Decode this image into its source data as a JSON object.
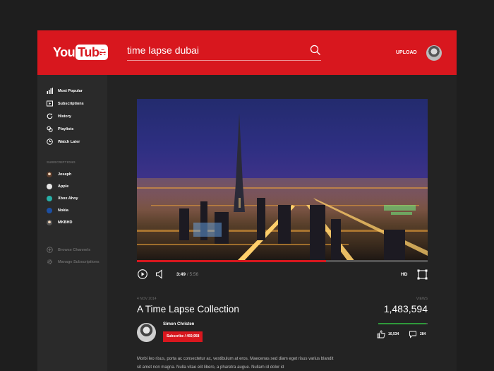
{
  "header": {
    "logo": {
      "you": "You",
      "tube": "Tube"
    },
    "search": {
      "value": "time lapse dubai"
    },
    "upload_label": "UPLOAD"
  },
  "sidebar": {
    "nav": [
      {
        "label": "Most Popular",
        "icon": "bar-chart-icon"
      },
      {
        "label": "Subscriptions",
        "icon": "play-box-icon"
      },
      {
        "label": "History",
        "icon": "history-icon"
      },
      {
        "label": "Playlists",
        "icon": "playlist-icon"
      },
      {
        "label": "Watch Later",
        "icon": "clock-icon"
      }
    ],
    "subscriptions_title": "SUBSCRIPTIONS",
    "subscriptions": [
      {
        "label": "Joseph",
        "color": "#c9a07a"
      },
      {
        "label": "Apple",
        "color": "#e6e6e6"
      },
      {
        "label": "Xbox Ahoy",
        "color": "#27b0a8"
      },
      {
        "label": "Nokia",
        "color": "#1c4fa3"
      },
      {
        "label": "MKBHD",
        "color": "#cccccc"
      }
    ],
    "footer": [
      {
        "label": "Browse Channels",
        "icon": "plus-circle-icon"
      },
      {
        "label": "Manage Subscriptions",
        "icon": "gear-icon"
      }
    ]
  },
  "player": {
    "current_time": "3:49",
    "separator": "/",
    "duration": "5:56",
    "progress": 0.65,
    "quality": "HD"
  },
  "video": {
    "date": "4 NOV 2014",
    "title": "A Time Lapse Collection",
    "views_label": "VIEWS",
    "views": "1,483,594",
    "like_ratio": 0.97,
    "channel": "Simon Christen",
    "subscribe": "Subscribe",
    "subscribe_sep": "/",
    "subscribers": "459,958",
    "likes": "10,534",
    "dislikes": "284",
    "description": "Morbi leo risus, porta ac consectetur ac, vestibulum at eros. Maecenas sed diam eget risus varius blandit sit amet non magna. Nulla vitae elit libero, a pharetra augue. Nullam id dolor id"
  },
  "colors": {
    "brand": "#d8171e",
    "background": "#1e1e1e",
    "sidebar": "#2a2a2a",
    "content": "#232323",
    "like_bar": "#2f9a3b"
  }
}
